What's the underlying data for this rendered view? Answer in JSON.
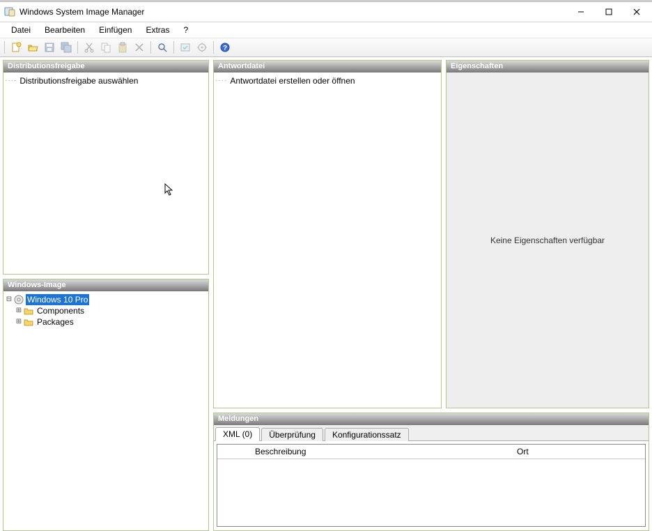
{
  "app": {
    "title": "Windows System Image Manager"
  },
  "menus": {
    "file": "Datei",
    "edit": "Bearbeiten",
    "insert": "Einfügen",
    "extras": "Extras",
    "help": "?"
  },
  "panels": {
    "distribution": {
      "title": "Distributionsfreigabe",
      "placeholder": "Distributionsfreigabe auswählen"
    },
    "image": {
      "title": "Windows-Image",
      "root": "Windows 10 Pro",
      "components": "Components",
      "packages": "Packages"
    },
    "answer": {
      "title": "Antwortdatei",
      "placeholder": "Antwortdatei erstellen oder öffnen"
    },
    "properties": {
      "title": "Eigenschaften",
      "empty": "Keine Eigenschaften verfügbar"
    },
    "messages": {
      "title": "Meldungen",
      "tabs": {
        "xml": "XML (0)",
        "validation": "Überprüfung",
        "configset": "Konfigurationssatz"
      },
      "columns": {
        "description": "Beschreibung",
        "location": "Ort"
      }
    }
  }
}
